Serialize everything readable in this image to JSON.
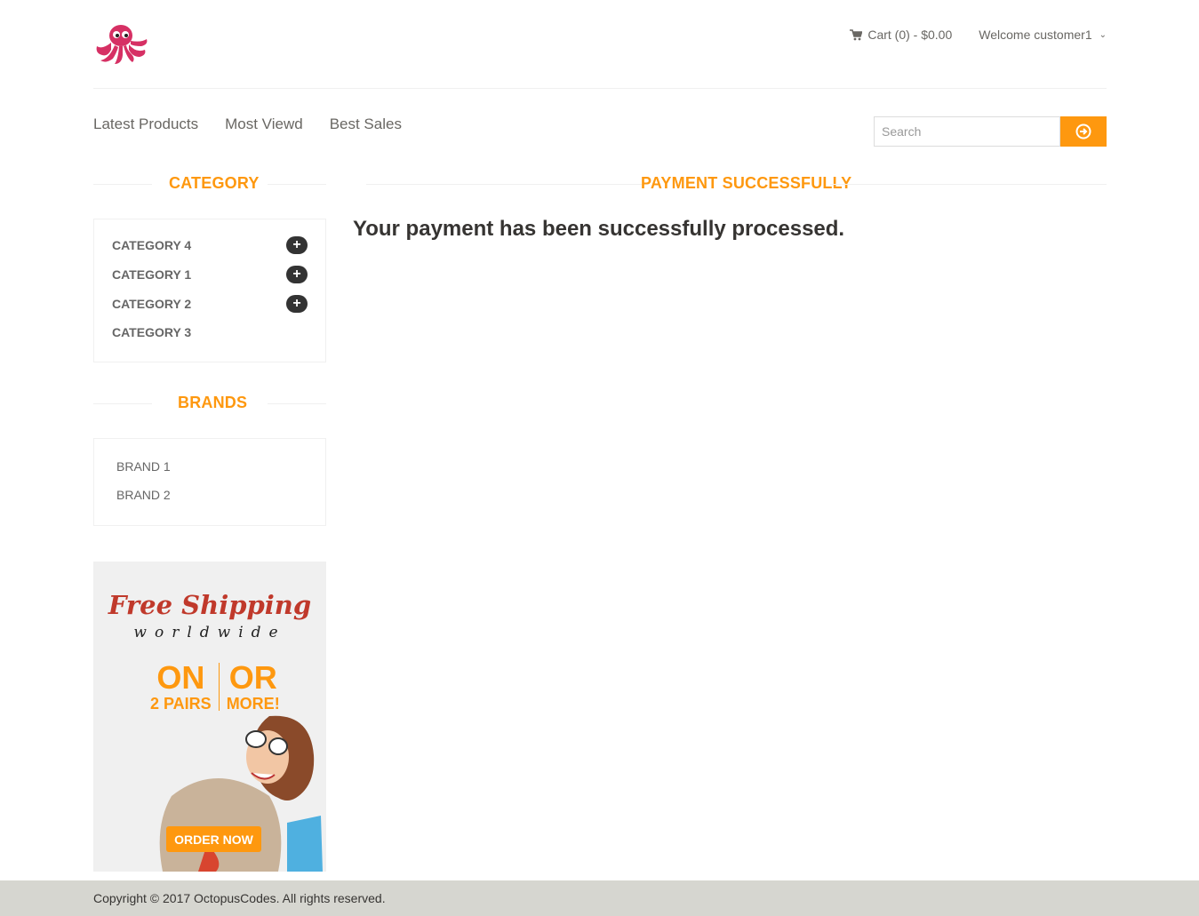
{
  "header": {
    "cart": "Cart (0) - $0.00",
    "welcome": "Welcome customer1"
  },
  "nav": {
    "items": [
      "Latest Products",
      "Most Viewd",
      "Best Sales"
    ]
  },
  "search": {
    "placeholder": "Search"
  },
  "sidebar": {
    "category_title": "CATEGORY",
    "categories": [
      {
        "label": "CATEGORY 4",
        "expandable": true
      },
      {
        "label": "CATEGORY 1",
        "expandable": true
      },
      {
        "label": "CATEGORY 2",
        "expandable": true
      },
      {
        "label": "CATEGORY 3",
        "expandable": false
      }
    ],
    "brands_title": "BRANDS",
    "brands": [
      "BRAND 1",
      "BRAND 2"
    ]
  },
  "ad": {
    "headline": "Free Shipping",
    "subline": "worldwide",
    "on": "ON",
    "pairs": "2 PAIRS",
    "or": "OR",
    "more": "MORE!",
    "button": "ORDER NOW"
  },
  "main": {
    "title": "PAYMENT SUCCESSFULLY",
    "message": "Your payment has been successfully processed."
  },
  "footer": {
    "copyright": "Copyright © 2017 OctopusCodes. All rights reserved."
  },
  "colors": {
    "accent": "#fe980f",
    "text": "#696763",
    "footer_bg": "#d6d6d0"
  }
}
